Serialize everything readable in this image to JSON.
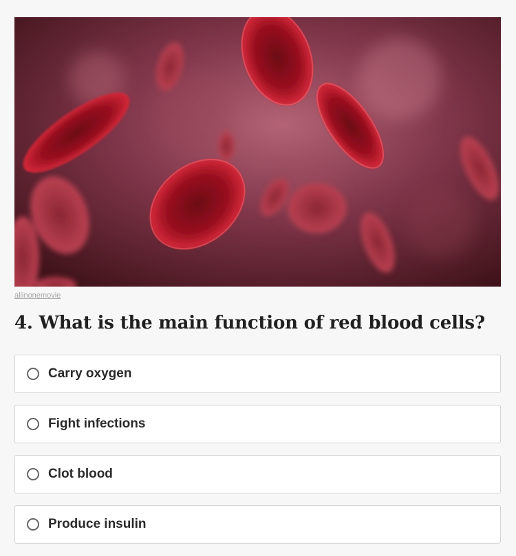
{
  "hero_image": {
    "subject": "red blood cells illustration",
    "credit": "allinonemovie"
  },
  "question": {
    "number": "4.",
    "text": "What is the main function of red blood cells?",
    "full": "4. What is the main function of red blood cells?"
  },
  "options": [
    {
      "label": "Carry oxygen",
      "selected": false
    },
    {
      "label": "Fight infections",
      "selected": false
    },
    {
      "label": "Clot blood",
      "selected": false
    },
    {
      "label": "Produce insulin",
      "selected": false
    }
  ],
  "colors": {
    "page_background": "#f7f7f7",
    "card_border": "#d4d4d4",
    "image_dark": "#5a1b26",
    "cell_red": "#c5182a"
  }
}
